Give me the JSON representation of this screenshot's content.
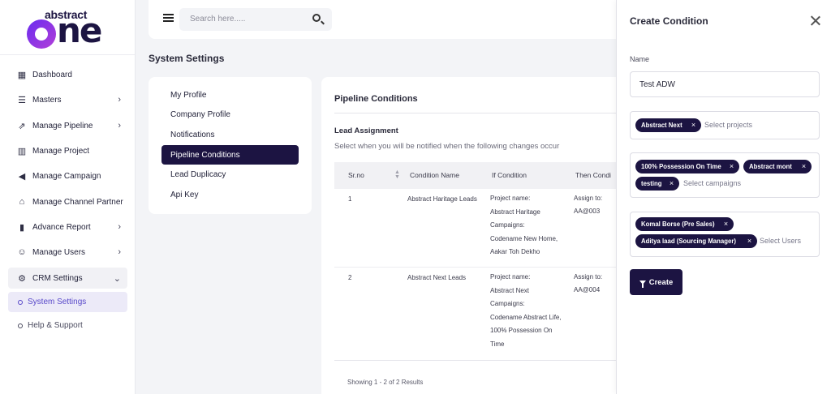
{
  "logo": {
    "top": "abstract",
    "bottom": "ne"
  },
  "sidebar": {
    "items": [
      {
        "label": "Dashboard",
        "icon": "grid-icon",
        "chevron": false
      },
      {
        "label": "Masters",
        "icon": "list-icon",
        "chevron": true
      },
      {
        "label": "Manage Pipeline",
        "icon": "pipeline-icon",
        "chevron": true
      },
      {
        "label": "Manage Project",
        "icon": "building-icon",
        "chevron": false
      },
      {
        "label": "Manage Campaign",
        "icon": "megaphone-icon",
        "chevron": false
      },
      {
        "label": "Manage Channel Partner",
        "icon": "house-user-icon",
        "chevron": false
      },
      {
        "label": "Advance Report",
        "icon": "bar-chart-icon",
        "chevron": true
      },
      {
        "label": "Manage Users",
        "icon": "users-icon",
        "chevron": true
      },
      {
        "label": "CRM Settings",
        "icon": "gear-icon",
        "chevron": true
      }
    ],
    "sub_items": [
      {
        "label": "System Settings"
      },
      {
        "label": "Help & Support"
      }
    ]
  },
  "header": {
    "search_placeholder": "Search here....."
  },
  "page_title": "System Settings",
  "settings_menu": [
    "My Profile",
    "Company Profile",
    "Notifications",
    "Pipeline Conditions",
    "Lead Duplicacy",
    "Api Key"
  ],
  "pipeline": {
    "title": "Pipeline Conditions",
    "section_title": "Lead Assignment",
    "section_sub": "Select when you will be notified when the following changes occur",
    "columns": [
      "Sr.no",
      "Condition Name",
      "If Condition",
      "Then Condi"
    ],
    "rows": [
      {
        "srno": "1",
        "name": "Abstract Haritage Leads",
        "if_lines": [
          "Project name:",
          "Abstract Haritage",
          "Campaigns:",
          "Codename New Home,",
          "Aakar Toh Dekho"
        ],
        "then_lines": [
          "Assign to:",
          "AA@003"
        ]
      },
      {
        "srno": "2",
        "name": "Abstract Next Leads",
        "if_lines": [
          "Project name:",
          "Abstract Next",
          "Campaigns:",
          "Codename Abstract Life,",
          "100% Possession On",
          "Time"
        ],
        "then_lines": [
          "Assign to:",
          "AA@004"
        ]
      }
    ],
    "footer": "Showing 1 - 2 of 2 Results"
  },
  "drawer": {
    "title": "Create Condition",
    "name_label": "Name",
    "name_value": "Test ADW",
    "projects": {
      "chips": [
        "Abstract Next"
      ],
      "placeholder": "Select projects"
    },
    "campaigns": {
      "chips": [
        "100% Possession On Time",
        "Abstract mont",
        "testing"
      ],
      "placeholder": "Select campaigns"
    },
    "users": {
      "chips": [
        "Komal Borse (Pre Sales)",
        "Aditya laad (Sourcing Manager)"
      ],
      "placeholder": "Select Users"
    },
    "create_label": "Create"
  },
  "colors": {
    "primary": "#1c1442",
    "accent": "#5747c9"
  }
}
